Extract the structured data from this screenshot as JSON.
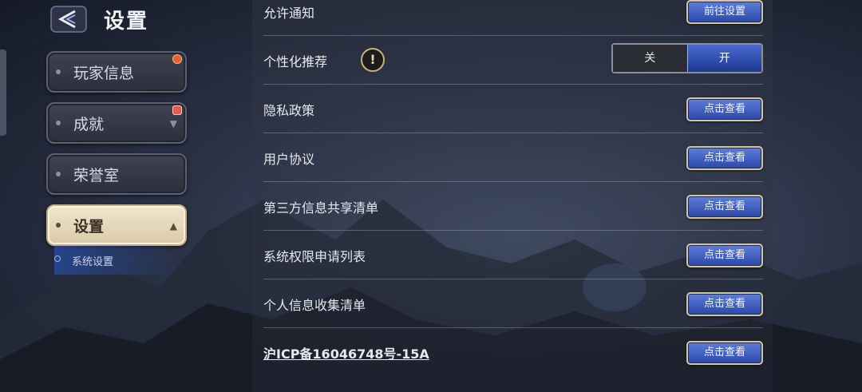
{
  "header": {
    "title": "设置",
    "back_icon": "back-arrow-icon"
  },
  "nav": {
    "items": [
      {
        "label": "玩家信息",
        "badge": "red-dot",
        "active": false
      },
      {
        "label": "成就",
        "badge": "gift",
        "active": false
      },
      {
        "label": "荣誉室",
        "badge": "",
        "active": false
      },
      {
        "label": "设置",
        "badge": "",
        "active": true
      }
    ],
    "sub_items": [
      {
        "label": "系统设置"
      }
    ]
  },
  "settings": {
    "rows": [
      {
        "label": "允许通知",
        "button": "前往设置"
      },
      {
        "label": "个性化推荐",
        "toggle": {
          "off": "关",
          "on": "开",
          "value": "on"
        }
      },
      {
        "label": "隐私政策",
        "button": "点击查看"
      },
      {
        "label": "用户协议",
        "button": "点击查看"
      },
      {
        "label": "第三方信息共享清单",
        "button": "点击查看"
      },
      {
        "label": "系统权限申请列表",
        "button": "点击查看"
      },
      {
        "label": "个人信息收集清单",
        "button": "点击查看"
      },
      {
        "label": "沪ICP备16046748号-15A",
        "button": "点击查看"
      }
    ]
  },
  "colors": {
    "button": "#2b47a8",
    "button_border": "#d6c79a",
    "active_nav": "#e3d7b9",
    "badge": "#e8602c"
  }
}
